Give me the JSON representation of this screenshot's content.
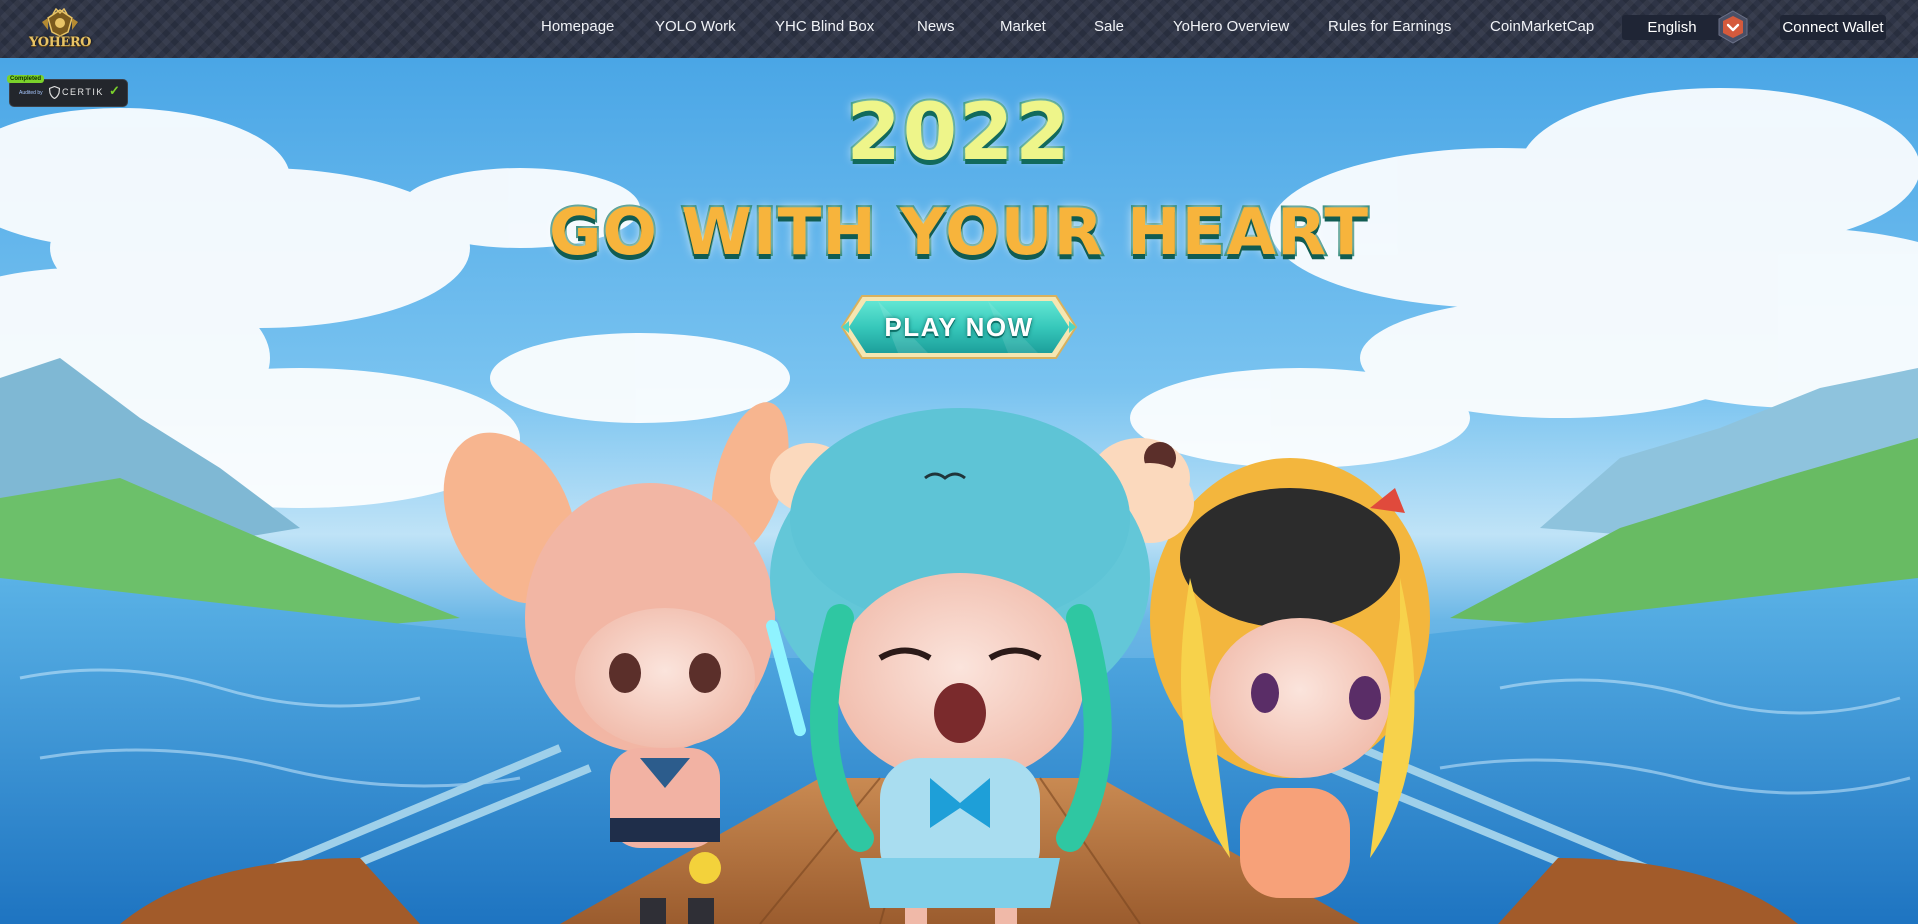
{
  "header": {
    "logo_text": "YOHERO",
    "nav": [
      {
        "label": "Homepage"
      },
      {
        "label": "YOLO Work"
      },
      {
        "label": "YHC Blind Box"
      },
      {
        "label": "News"
      },
      {
        "label": "Market"
      },
      {
        "label": "Sale"
      },
      {
        "label": "YoHero Overview"
      },
      {
        "label": "Rules for Earnings"
      },
      {
        "label": "CoinMarketCap"
      }
    ],
    "language": "English",
    "connect_wallet": "Connect Wallet"
  },
  "certik": {
    "status": "Completed",
    "audited_by": "Audited by",
    "name": "CERTIK",
    "check": "✓"
  },
  "hero": {
    "year": "2022",
    "slogan": "GO WITH YOUR HEART",
    "play_button": "PLAY NOW"
  },
  "colors": {
    "header_bg": "#2e3446",
    "sky": "#5fb5ea",
    "sea": "#2b86cf",
    "title_year": "#eef58a",
    "title_slogan": "#f7b43c",
    "title_outline": "#1c8b72",
    "play_button": "#3ed3c3"
  },
  "icons": {
    "language_dropdown": "chevron-down-icon",
    "logo": "yohero-crest-logo",
    "audit": "certik-shield-icon"
  }
}
